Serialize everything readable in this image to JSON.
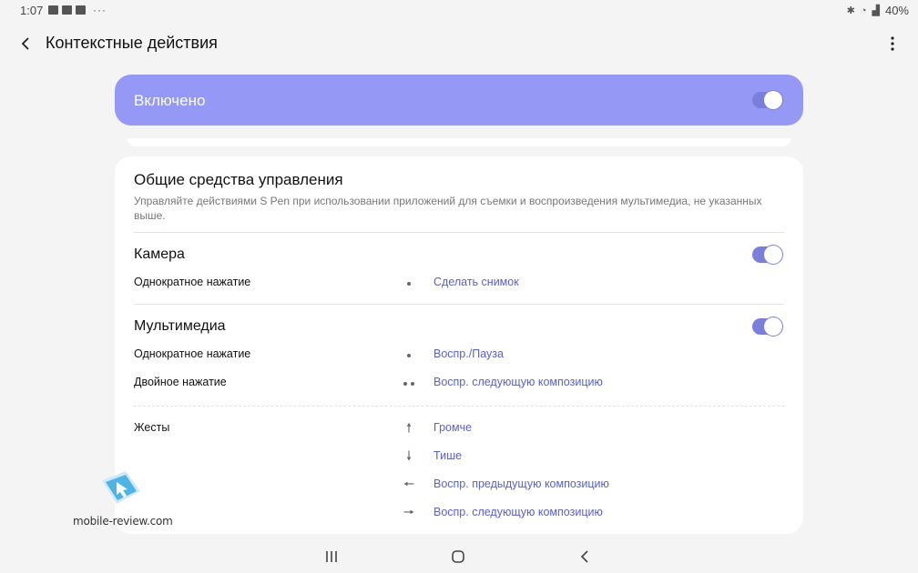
{
  "status_bar": {
    "time": "1:07",
    "dots": "···",
    "battery": "40%"
  },
  "app_bar": {
    "title": "Контекстные действия"
  },
  "master_toggle": {
    "label": "Включено",
    "enabled": true,
    "accent_color": "#9599f5"
  },
  "general_controls": {
    "title": "Общие средства управления",
    "description": "Управляйте действиями S Pen при использовании приложений для съемки и воспроизведения мультимедиа, не указанных выше.",
    "camera": {
      "title": "Камера",
      "enabled": true,
      "actions": [
        {
          "label": "Однократное нажатие",
          "gesture": "single-dot",
          "value": "Сделать снимок"
        }
      ]
    },
    "multimedia": {
      "title": "Мультимедиа",
      "enabled": true,
      "actions": [
        {
          "label": "Однократное нажатие",
          "gesture": "single-dot",
          "value": "Воспр./Пауза"
        },
        {
          "label": "Двойное нажатие",
          "gesture": "double-dot",
          "value": "Воспр. следующую композицию"
        }
      ],
      "gestures_label": "Жесты",
      "gestures": [
        {
          "gesture": "arrow-up",
          "glyph": "🠕",
          "value": "Громче"
        },
        {
          "gesture": "arrow-down",
          "glyph": "🠗",
          "value": "Тише"
        },
        {
          "gesture": "arrow-left",
          "glyph": "🠔",
          "value": "Воспр. предыдущую композицию"
        },
        {
          "gesture": "arrow-right",
          "glyph": "🠖",
          "value": "Воспр. следующую композицию"
        }
      ]
    }
  },
  "link_color": "#5a61c9",
  "watermark": {
    "text": "mobile-review.com"
  }
}
